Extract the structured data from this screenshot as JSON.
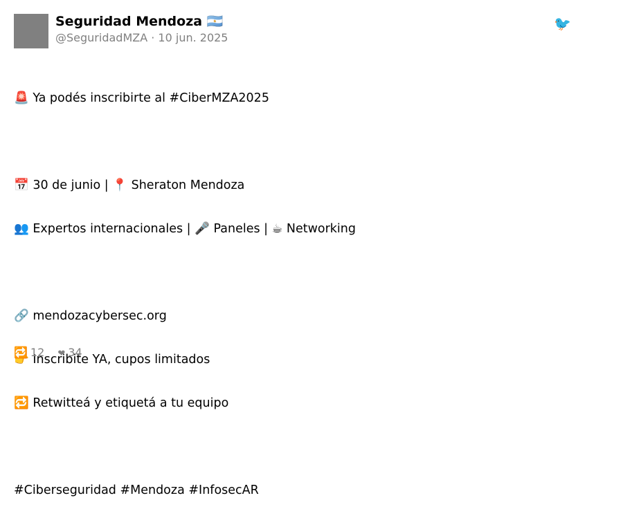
{
  "tweet": {
    "author": {
      "name": "Seguridad Mendoza 🇦🇷",
      "handle": "@SeguridadMZA",
      "separator": " · ",
      "date": "10 jun. 2025",
      "avatar_color": "#808080"
    },
    "platform_icon": {
      "name": "bird-icon",
      "glyph": "🐦",
      "color": "#7fc3dc"
    },
    "lines": [
      "🚨 Ya podés inscribirte al #CiberMZA2025",
      "",
      "📅 30 de junio | 📍 Sheraton Mendoza",
      "👥 Expertos internacionales | 🎤 Paneles | ☕ Networking",
      "",
      "🔗 mendozacybersec.org",
      "👉 Inscribite YA, cupos limitados",
      "🔁 Retwitteá y etiquetá a tu equipo",
      "",
      "#Ciberseguridad #Mendoza #InfosecAR"
    ],
    "stats": {
      "retweets": {
        "icon": "retweet-icon",
        "glyph": "🔁",
        "count": "12"
      },
      "likes": {
        "icon": "heart-icon",
        "glyph": "❤",
        "count": "34"
      }
    }
  }
}
